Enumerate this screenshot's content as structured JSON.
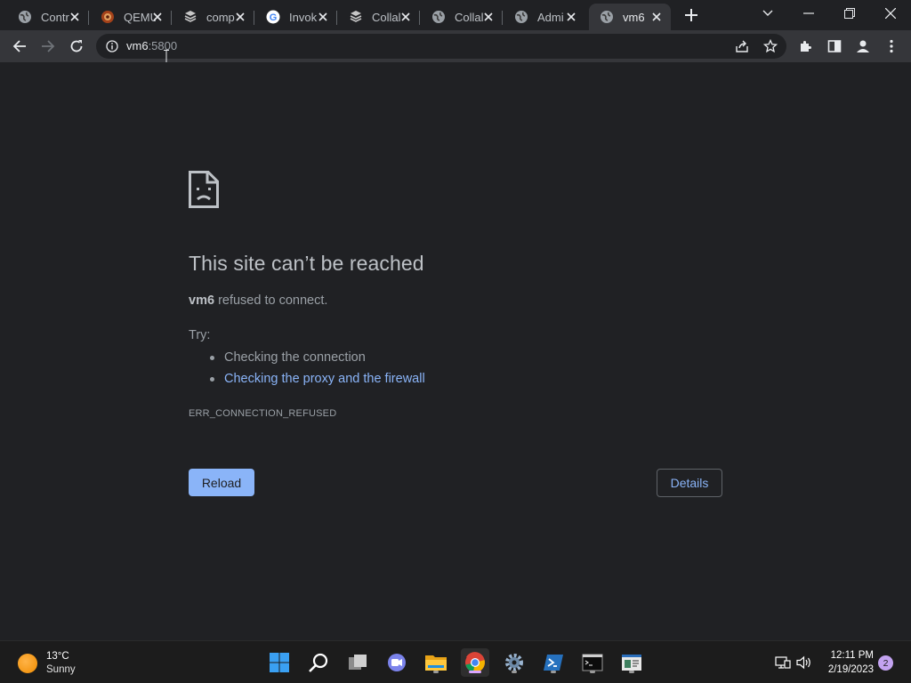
{
  "tabs": [
    {
      "title": "Contr",
      "icon": "globe-icon"
    },
    {
      "title": "QEMU",
      "icon": "qemu-icon"
    },
    {
      "title": "comp",
      "icon": "collab-icon"
    },
    {
      "title": "Invok",
      "icon": "google-icon"
    },
    {
      "title": "Collal",
      "icon": "collab-icon"
    },
    {
      "title": "Collal",
      "icon": "globe-icon"
    },
    {
      "title": "Admi",
      "icon": "globe-icon"
    },
    {
      "title": "vm6",
      "icon": "globe-icon",
      "active": true
    }
  ],
  "omnibox": {
    "host": "vm6",
    "port": ":5800"
  },
  "error": {
    "title": "This site can’t be reached",
    "host": "vm6",
    "message": "refused to connect.",
    "try_label": "Try:",
    "suggestions": [
      "Checking the connection",
      "Checking the proxy and the firewall"
    ],
    "code": "ERR_CONNECTION_REFUSED",
    "reload_label": "Reload",
    "details_label": "Details"
  },
  "taskbar": {
    "weather": {
      "temp": "13°C",
      "condition": "Sunny"
    },
    "apps": [
      "start-icon",
      "search-icon",
      "task-view-icon",
      "teams-chat-icon",
      "file-explorer-icon",
      "chrome-icon",
      "settings-icon",
      "powershell-icon",
      "terminal-icon",
      "remote-desktop-icon"
    ],
    "clock": {
      "time": "12:11 PM",
      "date": "2/19/2023"
    },
    "notifications": "2"
  },
  "colors": {
    "background": "#202124",
    "accent": "#8ab4f8",
    "toolbar": "#35363a"
  }
}
